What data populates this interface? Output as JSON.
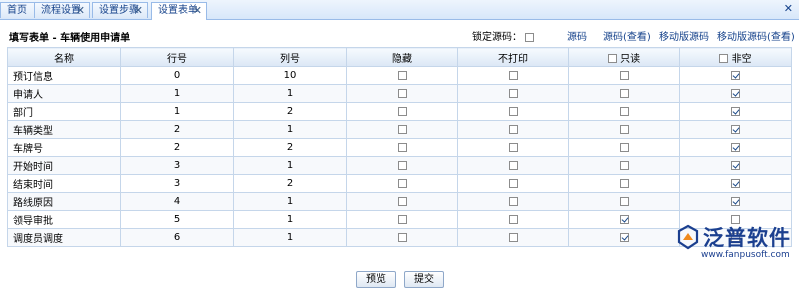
{
  "tabs": [
    {
      "label": "首页",
      "closable": false,
      "active": false
    },
    {
      "label": "流程设置",
      "closable": true,
      "active": false
    },
    {
      "label": "设置步骤",
      "closable": true,
      "active": false
    },
    {
      "label": "设置表单",
      "closable": true,
      "active": true
    }
  ],
  "form": {
    "title": "填写表单 - 车辆使用申请单",
    "lock_label": "锁定源码：",
    "lock_checked": false,
    "links": [
      "源码",
      "源码(查看)",
      "移动版源码",
      "移动版源码(查看)"
    ]
  },
  "table": {
    "headers": {
      "name": "名称",
      "row": "行号",
      "col": "列号",
      "hidden": "隐藏",
      "noprint": "不打印",
      "readonly": "只读",
      "notnull": "非空"
    },
    "rows": [
      {
        "name": "预订信息",
        "row": "0",
        "col": "10",
        "hidden": false,
        "noprint": false,
        "readonly": false,
        "notnull": true
      },
      {
        "name": "申请人",
        "row": "1",
        "col": "1",
        "hidden": false,
        "noprint": false,
        "readonly": false,
        "notnull": true
      },
      {
        "name": "部门",
        "row": "1",
        "col": "2",
        "hidden": false,
        "noprint": false,
        "readonly": false,
        "notnull": true
      },
      {
        "name": "车辆类型",
        "row": "2",
        "col": "1",
        "hidden": false,
        "noprint": false,
        "readonly": false,
        "notnull": true
      },
      {
        "name": "车牌号",
        "row": "2",
        "col": "2",
        "hidden": false,
        "noprint": false,
        "readonly": false,
        "notnull": true
      },
      {
        "name": "开始时间",
        "row": "3",
        "col": "1",
        "hidden": false,
        "noprint": false,
        "readonly": false,
        "notnull": true
      },
      {
        "name": "结束时间",
        "row": "3",
        "col": "2",
        "hidden": false,
        "noprint": false,
        "readonly": false,
        "notnull": true
      },
      {
        "name": "路线原因",
        "row": "4",
        "col": "1",
        "hidden": false,
        "noprint": false,
        "readonly": false,
        "notnull": true
      },
      {
        "name": "领导审批",
        "row": "5",
        "col": "1",
        "hidden": false,
        "noprint": false,
        "readonly": true,
        "notnull": false
      },
      {
        "name": "调度员调度",
        "row": "6",
        "col": "1",
        "hidden": false,
        "noprint": false,
        "readonly": true,
        "notnull": false
      }
    ]
  },
  "buttons": {
    "preview": "预览",
    "submit": "提交"
  },
  "logo": {
    "brand": "泛普软件",
    "url": "www.fanpusoft.com"
  },
  "colors": {
    "accent": "#15428b",
    "header_border": "#99bbe8",
    "brand": "#1b3f8f",
    "logo_orange": "#f08a1c"
  }
}
